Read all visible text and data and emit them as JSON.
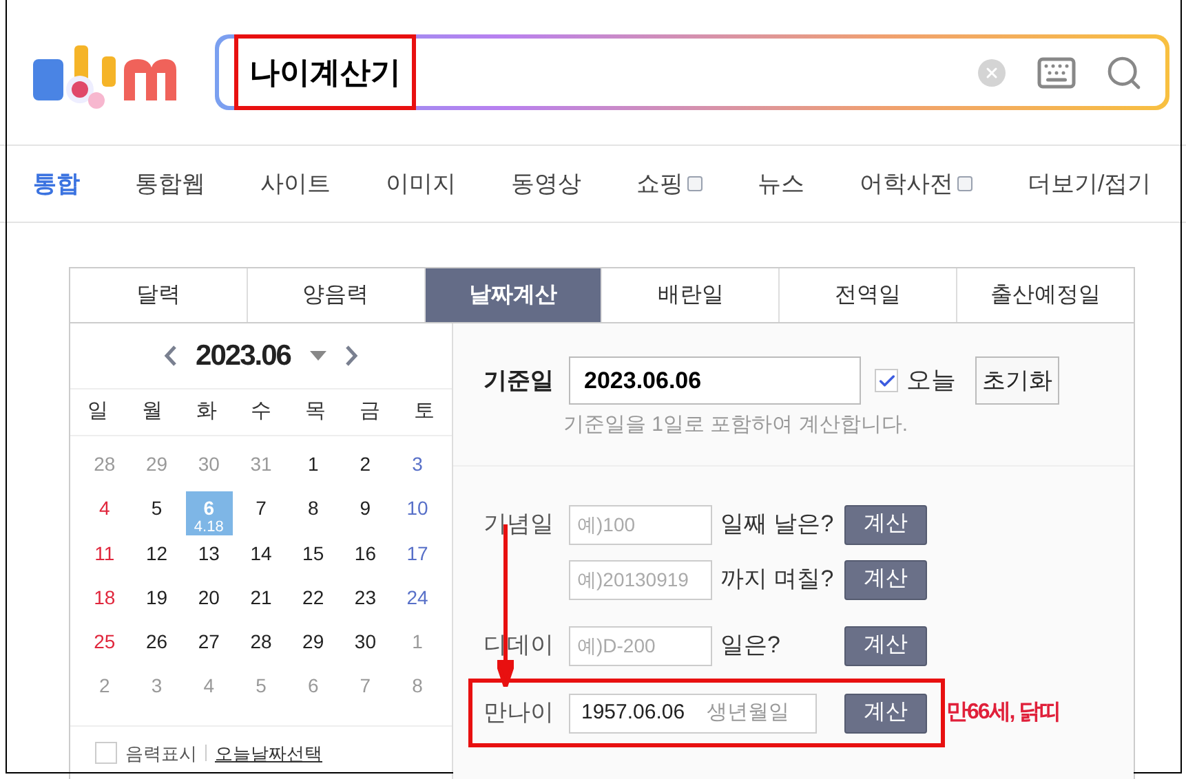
{
  "search": {
    "value": "나이계산기",
    "highlighted": true
  },
  "nav": [
    {
      "label": "통합",
      "selected": true,
      "external": false
    },
    {
      "label": "통합웹",
      "selected": false,
      "external": false
    },
    {
      "label": "사이트",
      "selected": false,
      "external": false
    },
    {
      "label": "이미지",
      "selected": false,
      "external": false
    },
    {
      "label": "동영상",
      "selected": false,
      "external": false
    },
    {
      "label": "쇼핑",
      "selected": false,
      "external": true
    },
    {
      "label": "뉴스",
      "selected": false,
      "external": false
    },
    {
      "label": "어학사전",
      "selected": false,
      "external": true
    },
    {
      "label": "더보기/접기",
      "selected": false,
      "external": false
    }
  ],
  "calc_tabs": [
    {
      "label": "달력",
      "selected": false
    },
    {
      "label": "양음력",
      "selected": false
    },
    {
      "label": "날짜계산",
      "selected": true
    },
    {
      "label": "배란일",
      "selected": false
    },
    {
      "label": "전역일",
      "selected": false
    },
    {
      "label": "출산예정일",
      "selected": false
    }
  ],
  "calendar": {
    "month": "2023.06",
    "weekdays": [
      "일",
      "월",
      "화",
      "수",
      "목",
      "금",
      "토"
    ],
    "weeks": [
      [
        {
          "day": "28",
          "muted": true,
          "selected": false
        },
        {
          "day": "29",
          "muted": true,
          "selected": false
        },
        {
          "day": "30",
          "muted": true,
          "selected": false
        },
        {
          "day": "31",
          "muted": true,
          "selected": false
        },
        {
          "day": "1",
          "muted": false,
          "selected": false
        },
        {
          "day": "2",
          "muted": false,
          "selected": false
        },
        {
          "day": "3",
          "muted": false,
          "selected": false
        }
      ],
      [
        {
          "day": "4",
          "muted": false,
          "selected": false
        },
        {
          "day": "5",
          "muted": false,
          "selected": false
        },
        {
          "day": "6",
          "muted": false,
          "selected": true,
          "lunar": "4.18"
        },
        {
          "day": "7",
          "muted": false,
          "selected": false
        },
        {
          "day": "8",
          "muted": false,
          "selected": false
        },
        {
          "day": "9",
          "muted": false,
          "selected": false
        },
        {
          "day": "10",
          "muted": false,
          "selected": false
        }
      ],
      [
        {
          "day": "11",
          "muted": false,
          "selected": false
        },
        {
          "day": "12",
          "muted": false,
          "selected": false
        },
        {
          "day": "13",
          "muted": false,
          "selected": false
        },
        {
          "day": "14",
          "muted": false,
          "selected": false
        },
        {
          "day": "15",
          "muted": false,
          "selected": false
        },
        {
          "day": "16",
          "muted": false,
          "selected": false
        },
        {
          "day": "17",
          "muted": false,
          "selected": false
        }
      ],
      [
        {
          "day": "18",
          "muted": false,
          "selected": false
        },
        {
          "day": "19",
          "muted": false,
          "selected": false
        },
        {
          "day": "20",
          "muted": false,
          "selected": false
        },
        {
          "day": "21",
          "muted": false,
          "selected": false
        },
        {
          "day": "22",
          "muted": false,
          "selected": false
        },
        {
          "day": "23",
          "muted": false,
          "selected": false
        },
        {
          "day": "24",
          "muted": false,
          "selected": false
        }
      ],
      [
        {
          "day": "25",
          "muted": false,
          "selected": false
        },
        {
          "day": "26",
          "muted": false,
          "selected": false
        },
        {
          "day": "27",
          "muted": false,
          "selected": false
        },
        {
          "day": "28",
          "muted": false,
          "selected": false
        },
        {
          "day": "29",
          "muted": false,
          "selected": false
        },
        {
          "day": "30",
          "muted": false,
          "selected": false
        },
        {
          "day": "1",
          "muted": true,
          "selected": false
        }
      ],
      [
        {
          "day": "2",
          "muted": true,
          "selected": false
        },
        {
          "day": "3",
          "muted": true,
          "selected": false
        },
        {
          "day": "4",
          "muted": true,
          "selected": false
        },
        {
          "day": "5",
          "muted": true,
          "selected": false
        },
        {
          "day": "6",
          "muted": true,
          "selected": false
        },
        {
          "day": "7",
          "muted": true,
          "selected": false
        },
        {
          "day": "8",
          "muted": true,
          "selected": false
        }
      ]
    ],
    "lunar_toggle": {
      "label": "음력표시",
      "checked": false
    },
    "today_link": "오늘날짜선택"
  },
  "base_date": {
    "label": "기준일",
    "value": "2023.06.06",
    "today": {
      "label": "오늘",
      "checked": true
    },
    "reset": "초기화",
    "note": "기준일을 1일로 포함하여 계산합니다."
  },
  "calc_rows": [
    {
      "label": "기념일",
      "placeholder": "예)100",
      "suffix": "일째 날은?",
      "button": "계산",
      "highlighted": false
    },
    {
      "placeholder": "예)20130919",
      "suffix": "까지 며칠?",
      "button": "계산",
      "highlighted": false
    },
    {
      "label": "디데이",
      "placeholder": "예)D-200",
      "suffix": "일은?",
      "button": "계산",
      "highlighted": false
    },
    {
      "label": "만나이",
      "value": "1957.06.06",
      "hint": "생년월일",
      "button": "계산",
      "result": "만66세, 닭띠",
      "highlighted": true
    }
  ]
}
